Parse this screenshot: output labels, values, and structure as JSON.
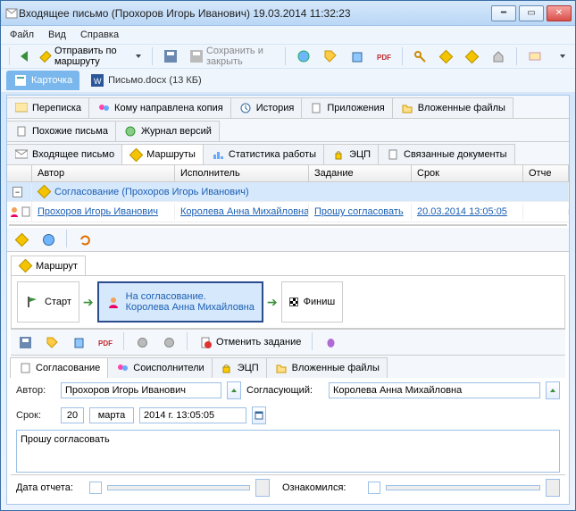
{
  "title": "Входящее письмо (Прохоров Игорь Иванович) 19.03.2014 11:32:23",
  "menu": {
    "file": "Файл",
    "view": "Вид",
    "help": "Справка"
  },
  "toolbar": {
    "send_route": "Отправить по маршруту",
    "save_close": "Сохранить и закрыть"
  },
  "doc_tabs": {
    "card": "Карточка",
    "attachment": "Письмо.docx (13 КБ)"
  },
  "tabs1": {
    "correspondence": "Переписка",
    "copy_to": "Кому направлена копия",
    "history": "История",
    "attachments": "Приложения",
    "embedded": "Вложенные файлы"
  },
  "tabs2": {
    "similar": "Похожие письма",
    "versions": "Журнал версий"
  },
  "tabs3": {
    "incoming": "Входящее письмо",
    "routes": "Маршруты",
    "stats": "Статистика работы",
    "eds": "ЭЦП",
    "linked": "Связанные документы"
  },
  "grid": {
    "headers": {
      "author": "Автор",
      "executor": "Исполнитель",
      "task": "Задание",
      "due": "Срок",
      "report": "Отче"
    },
    "group_row": "Согласование (Прохоров Игорь Иванович)",
    "rows": [
      {
        "author": "Прохоров Игорь Иванович",
        "executor": "Королева Анна Михайловна",
        "task": "Прошу согласовать",
        "due": "20.03.2014 13:05:05"
      }
    ]
  },
  "route": {
    "tab": "Маршрут",
    "start": "Старт",
    "step_title": "На согласование.",
    "step_person": "Королева Анна Михайловна",
    "finish": "Финиш"
  },
  "detail_toolbar": {
    "cancel_task": "Отменить задание"
  },
  "detail_tabs": {
    "approval": "Согласование",
    "coexec": "Соисполнители",
    "eds": "ЭЦП",
    "embedded": "Вложенные файлы"
  },
  "form": {
    "author_label": "Автор:",
    "author_value": "Прохоров Игорь Иванович",
    "approver_label": "Согласующий:",
    "approver_value": "Королева Анна Михайловна",
    "due_label": "Срок:",
    "due_day": "20",
    "due_month": "марта",
    "due_rest": "2014 г. 13:05:05",
    "task_text": "Прошу согласовать",
    "report_date_label": "Дата отчета:",
    "ack_label": "Ознакомился:"
  }
}
